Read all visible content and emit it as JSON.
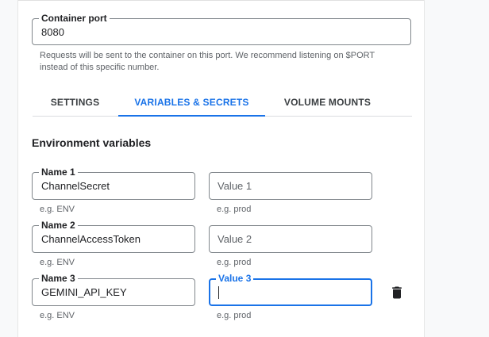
{
  "container_port": {
    "label": "Container port",
    "value": "8080",
    "helper": "Requests will be sent to the container on this port. We recommend listening on $PORT instead of this specific number."
  },
  "tabs": [
    {
      "label": "SETTINGS",
      "active": false
    },
    {
      "label": "VARIABLES & SECRETS",
      "active": true
    },
    {
      "label": "VOLUME MOUNTS",
      "active": false
    }
  ],
  "env": {
    "title": "Environment variables",
    "rows": [
      {
        "name_label": "Name 1",
        "name_value": "ChannelSecret",
        "name_helper": "e.g. ENV",
        "value_label": "Value 1",
        "value_value": "",
        "value_placeholder": "Value 1",
        "value_helper": "e.g. prod"
      },
      {
        "name_label": "Name 2",
        "name_value": "ChannelAccessToken",
        "name_helper": "e.g. ENV",
        "value_label": "Value 2",
        "value_value": "",
        "value_placeholder": "Value 2",
        "value_helper": "e.g. prod"
      },
      {
        "name_label": "Name 3",
        "name_value": "GEMINI_API_KEY",
        "name_helper": "e.g. ENV",
        "value_label": "Value 3",
        "value_value": "",
        "value_placeholder": "",
        "value_helper": "e.g. prod"
      }
    ]
  },
  "icons": {
    "delete": "trash-icon"
  },
  "colors": {
    "accent": "#1a73e8",
    "border": "#80868b",
    "helper_text": "#5f6368"
  }
}
